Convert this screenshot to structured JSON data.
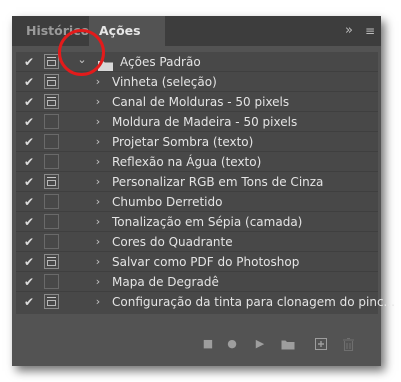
{
  "tabs": [
    {
      "label": "Histórico",
      "active": false
    },
    {
      "label": "Ações",
      "active": true
    }
  ],
  "icons": {
    "collapse": "double-chevron-right-icon",
    "menu": "hamburger-menu-icon",
    "check": "checkmark-icon",
    "dialog": "dialog-toggle-icon",
    "folder": "folder-icon",
    "expand": "chevron-right-icon",
    "expanded": "chevron-down-icon"
  },
  "glyphs": {
    "collapse": "»",
    "menu": "≡",
    "check": "✔",
    "chev_right": "›",
    "chev_down": "⌄"
  },
  "set": {
    "name": "Ações Padrão",
    "expanded": true,
    "dialog": true
  },
  "actions": [
    {
      "name": "Vinheta (seleção)",
      "dialog": true
    },
    {
      "name": "Canal de Molduras - 50 pixels",
      "dialog": true
    },
    {
      "name": "Moldura de Madeira - 50 pixels",
      "dialog": false
    },
    {
      "name": "Projetar Sombra (texto)",
      "dialog": false
    },
    {
      "name": "Reflexão na Água (texto)",
      "dialog": false
    },
    {
      "name": "Personalizar RGB em Tons de Cinza",
      "dialog": true
    },
    {
      "name": "Chumbo Derretido",
      "dialog": false
    },
    {
      "name": "Tonalização em Sépia (camada)",
      "dialog": false
    },
    {
      "name": "Cores do Quadrante",
      "dialog": false
    },
    {
      "name": "Salvar como PDF do Photoshop",
      "dialog": true
    },
    {
      "name": "Mapa de Degradê",
      "dialog": false
    },
    {
      "name": "Configuração da tinta para clonagem do pinc...",
      "dialog": true
    }
  ],
  "bottom_toolbar": [
    {
      "name": "stop-button",
      "icon": "stop-icon",
      "glyph": "■"
    },
    {
      "name": "record-button",
      "icon": "record-icon",
      "glyph": "●"
    },
    {
      "name": "play-button",
      "icon": "play-icon",
      "glyph": "▶"
    },
    {
      "name": "new-set-button",
      "icon": "folder-icon",
      "glyph": ""
    },
    {
      "name": "new-action-button",
      "icon": "new-item-icon",
      "glyph": ""
    },
    {
      "name": "delete-button",
      "icon": "trash-icon",
      "glyph": ""
    }
  ],
  "colors": {
    "panel": "#535353",
    "tabbar": "#3d3d3d",
    "list": "#484848",
    "text": "#e4e4e4",
    "highlight_circle": "#e31b1b"
  }
}
